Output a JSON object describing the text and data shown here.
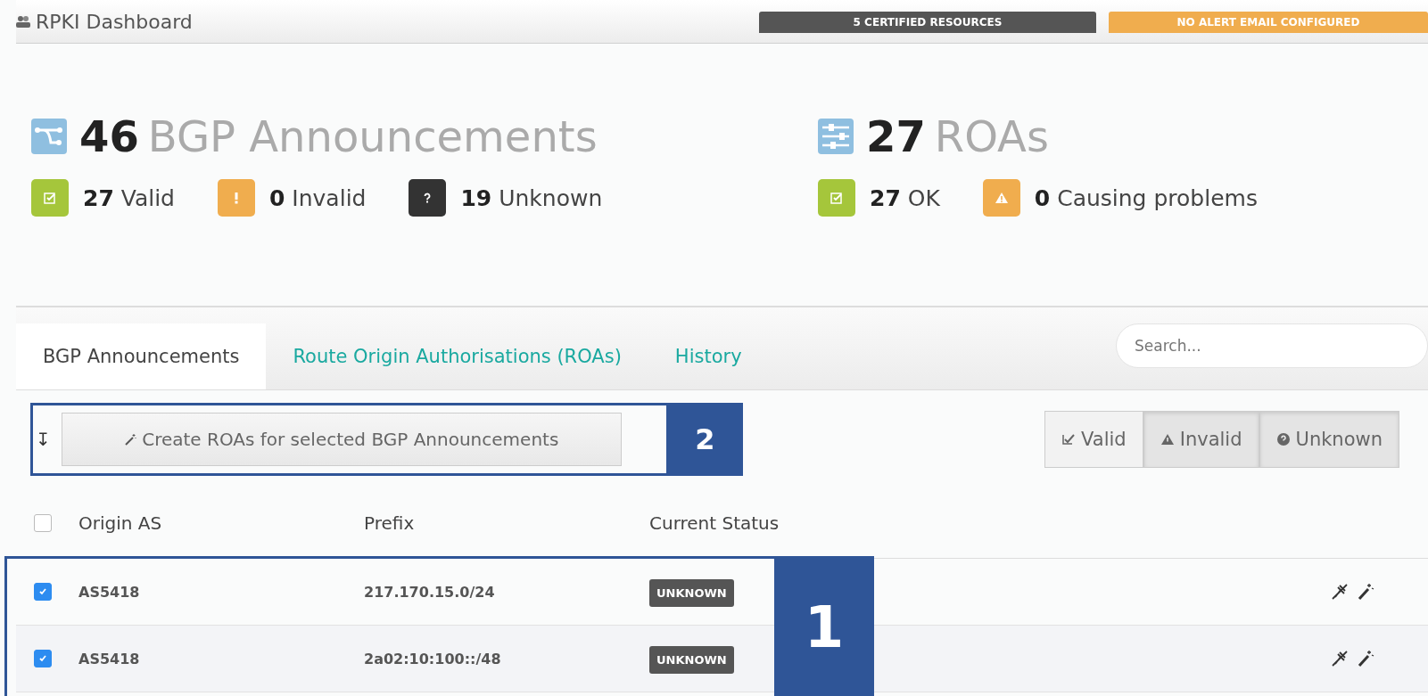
{
  "header": {
    "title": "RPKI Dashboard",
    "badges": [
      {
        "text": "5 CERTIFIED RESOURCES",
        "color": "#555555"
      },
      {
        "text": "NO ALERT EMAIL CONFIGURED",
        "color": "#f0ad4e"
      }
    ]
  },
  "summaries": [
    {
      "kind": "announcements",
      "count": "46",
      "label": "BGP Announcements",
      "stats": [
        {
          "kind": "valid",
          "count": "27",
          "label": "Valid"
        },
        {
          "kind": "invalid",
          "count": "0",
          "label": "Invalid"
        },
        {
          "kind": "unknown",
          "count": "19",
          "label": "Unknown"
        }
      ]
    },
    {
      "kind": "roas",
      "count": "27",
      "label": "ROAs",
      "stats": [
        {
          "kind": "valid",
          "count": "27",
          "label": "OK"
        },
        {
          "kind": "warning",
          "count": "0",
          "label": "Causing problems"
        }
      ]
    }
  ],
  "tabs": [
    {
      "label": "BGP Announcements",
      "selected": true
    },
    {
      "label": "Route Origin Authorisations (ROAs)",
      "selected": false
    },
    {
      "label": "History",
      "selected": false
    }
  ],
  "search": {
    "placeholder": "Search..."
  },
  "toolbar": {
    "sort_glyph": "↧",
    "create_button": "Create ROAs for selected BGP Announcements",
    "callout": "2"
  },
  "filters": [
    {
      "kind": "valid",
      "label": "Valid",
      "selected": false
    },
    {
      "kind": "invalid",
      "label": "Invalid",
      "selected": true
    },
    {
      "kind": "unknown",
      "label": "Unknown",
      "selected": true
    }
  ],
  "table": {
    "columns": [
      "Origin AS",
      "Prefix",
      "Current Status"
    ],
    "select_all": false,
    "callout": "1",
    "rows": [
      {
        "origin_as": "AS5418",
        "prefix": "217.170.15.0/24",
        "status": "UNKNOWN",
        "checked": true
      },
      {
        "origin_as": "AS5418",
        "prefix": "2a02:10:100::/48",
        "status": "UNKNOWN",
        "checked": true
      }
    ]
  }
}
